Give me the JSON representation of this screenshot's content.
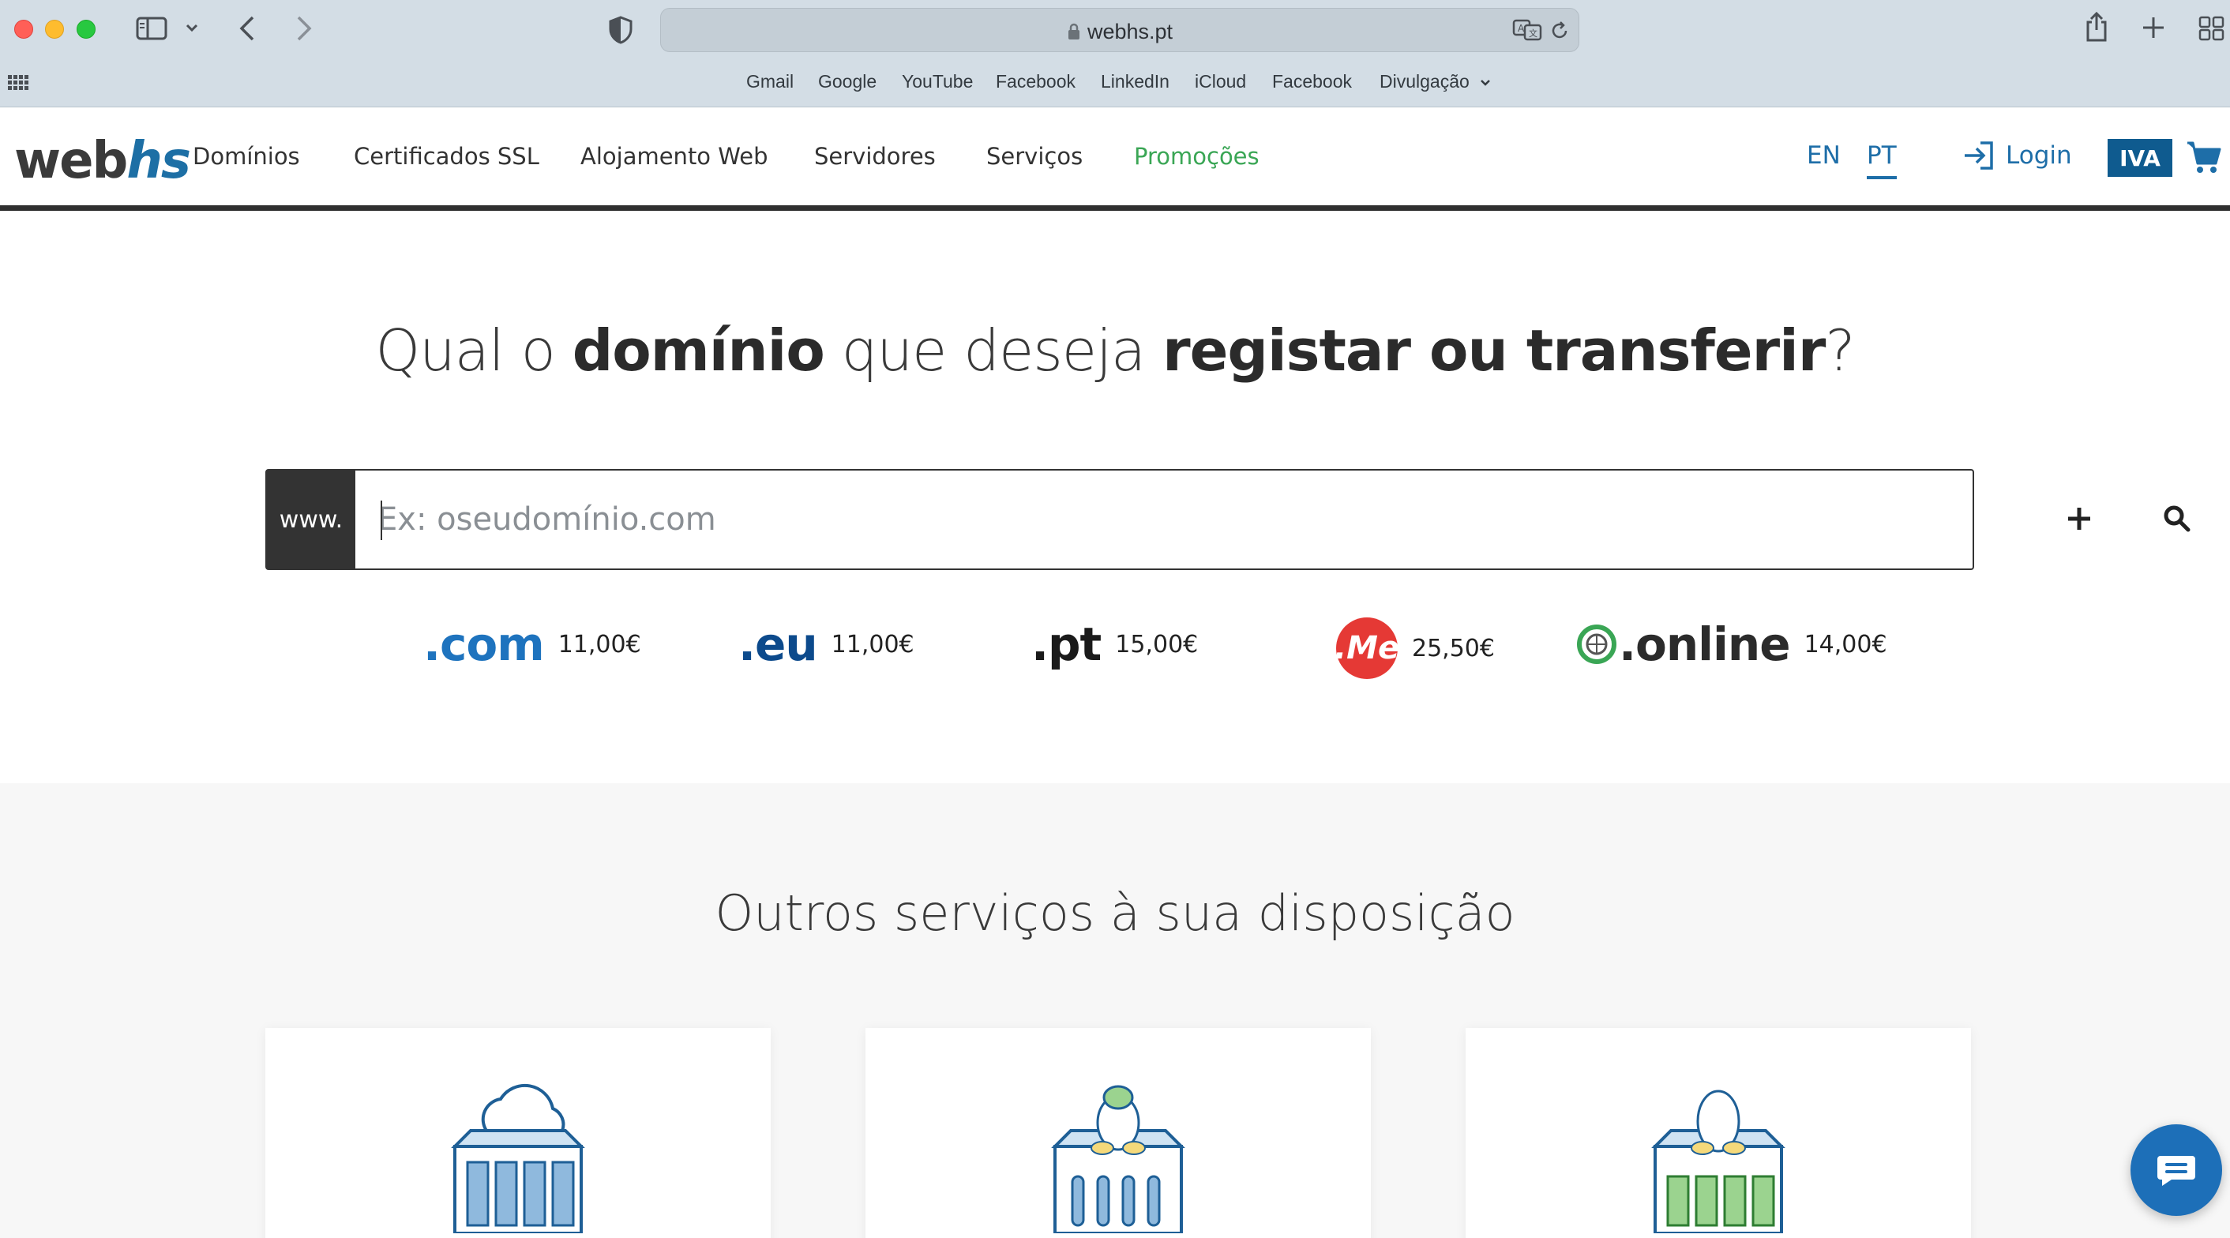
{
  "browser": {
    "url": "webhs.pt",
    "bookmarks": [
      "Gmail",
      "Google",
      "YouTube",
      "Facebook",
      "LinkedIn",
      "iCloud",
      "Facebook",
      "Divulgação"
    ]
  },
  "nav": {
    "logo_left": "web",
    "logo_right": "hs",
    "items": [
      "Domínios",
      "Certificados SSL",
      "Alojamento Web",
      "Servidores",
      "Serviços",
      "Promoções"
    ],
    "lang_en": "EN",
    "lang_pt": "PT",
    "login": "Login",
    "iva": "IVA"
  },
  "hero": {
    "title_1": "Qual o ",
    "title_2": "domínio",
    "title_3": " que deseja ",
    "title_4": "registar ou transferir",
    "title_5": "?",
    "www": "www.",
    "placeholder": "Ex: oseudomínio.com",
    "tlds": [
      {
        "name": ".com",
        "price": "11,00€"
      },
      {
        "name": ".eu",
        "price": "11,00€"
      },
      {
        "name": ".pt",
        "price": "15,00€"
      },
      {
        "name": ".Me",
        "price": "25,50€"
      },
      {
        "name": ".online",
        "price": "14,00€"
      }
    ]
  },
  "services": {
    "title": "Outros serviços à sua disposição"
  },
  "colors": {
    "brand_blue": "#1e6ea8",
    "promo_green": "#3aa655",
    "dark": "#333333"
  }
}
